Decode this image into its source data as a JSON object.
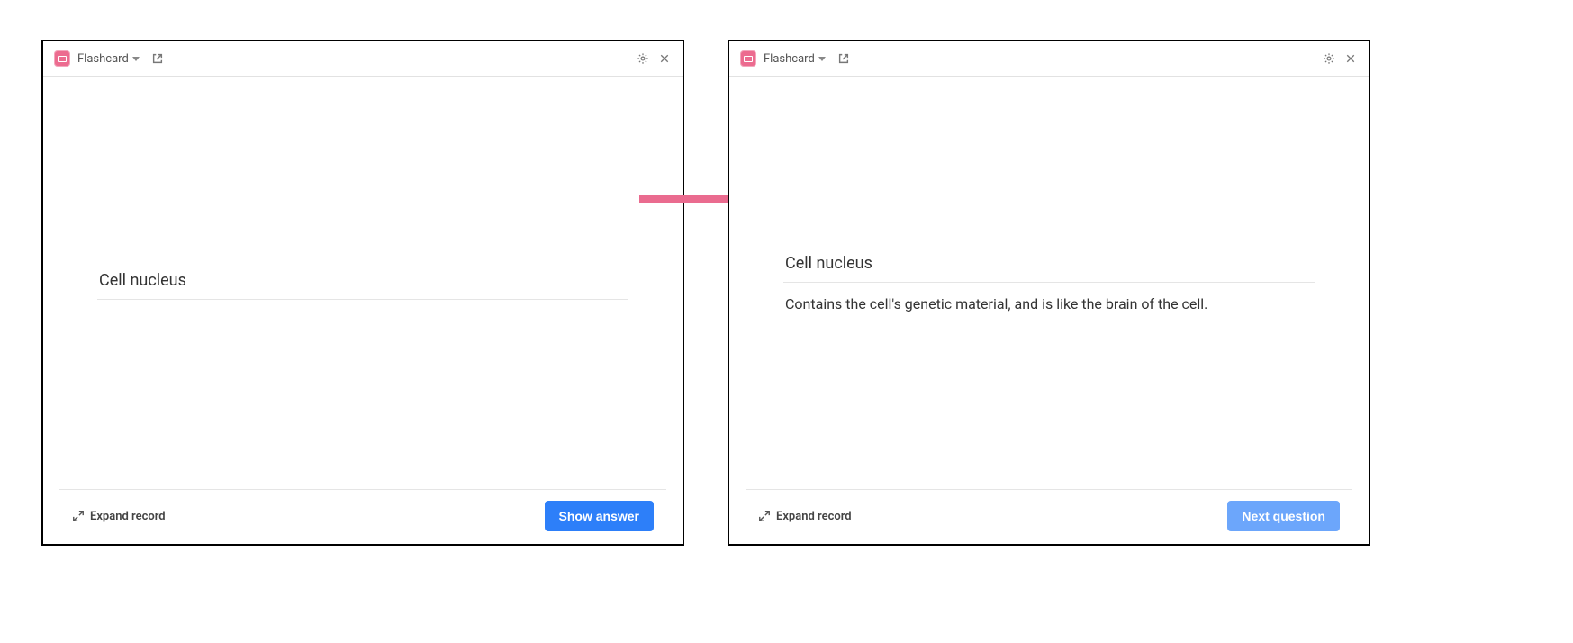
{
  "accent_color": "#2d7ff9",
  "arrow_color": "#ea6b8f",
  "header": {
    "app_name": "Flashcard"
  },
  "footer": {
    "expand_label": "Expand record"
  },
  "panels": {
    "before": {
      "question": "Cell nucleus",
      "button_label": "Show answer"
    },
    "after": {
      "question": "Cell nucleus",
      "answer": "Contains the cell's genetic material, and is like the brain of the cell.",
      "button_label": "Next question"
    }
  }
}
